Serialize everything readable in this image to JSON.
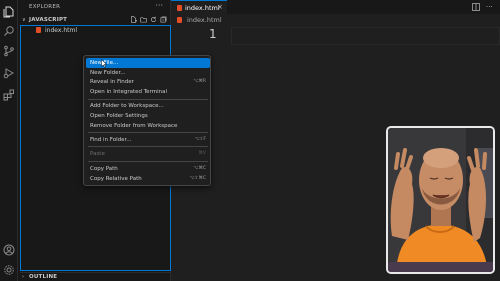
{
  "sidebar": {
    "title": "EXPLORER",
    "more_label": "···",
    "section_label": "JAVASCRIPT",
    "section_chevron": "∨",
    "files": [
      {
        "name": "index.html"
      }
    ],
    "outline_label": "OUTLINE",
    "outline_chevron": "›"
  },
  "tab": {
    "label": "index.html",
    "close": "×"
  },
  "breadcrumb": {
    "file": "index.html"
  },
  "editor": {
    "line_number": "1"
  },
  "tab_actions": {
    "more": "···"
  },
  "context_menu": {
    "items": [
      {
        "label": "New File...",
        "shortcut": "",
        "state": "active"
      },
      {
        "label": "New Folder...",
        "shortcut": ""
      },
      {
        "label": "Reveal in Finder",
        "shortcut": "⌥⌘R"
      },
      {
        "label": "Open in Integrated Terminal",
        "shortcut": ""
      },
      {
        "label": "Add Folder to Workspace...",
        "shortcut": ""
      },
      {
        "label": "Open Folder Settings",
        "shortcut": ""
      },
      {
        "label": "Remove Folder from Workspace",
        "shortcut": ""
      },
      {
        "label": "Find in Folder...",
        "shortcut": "⌥⇧F"
      },
      {
        "label": "Paste",
        "shortcut": "⌘V",
        "state": "disabled"
      },
      {
        "label": "Copy Path",
        "shortcut": "⌥⌘C"
      },
      {
        "label": "Copy Relative Path",
        "shortcut": "⌥⇧⌘C"
      }
    ]
  },
  "colors": {
    "accent": "#0078d4",
    "html_file": "#e44d26",
    "background": "#1f1f1f",
    "sidebar": "#181818"
  },
  "icons": {
    "activity": [
      "files-icon",
      "search-icon",
      "source-control-icon",
      "run-debug-icon",
      "extensions-icon",
      "account-icon",
      "settings-gear-icon"
    ]
  }
}
